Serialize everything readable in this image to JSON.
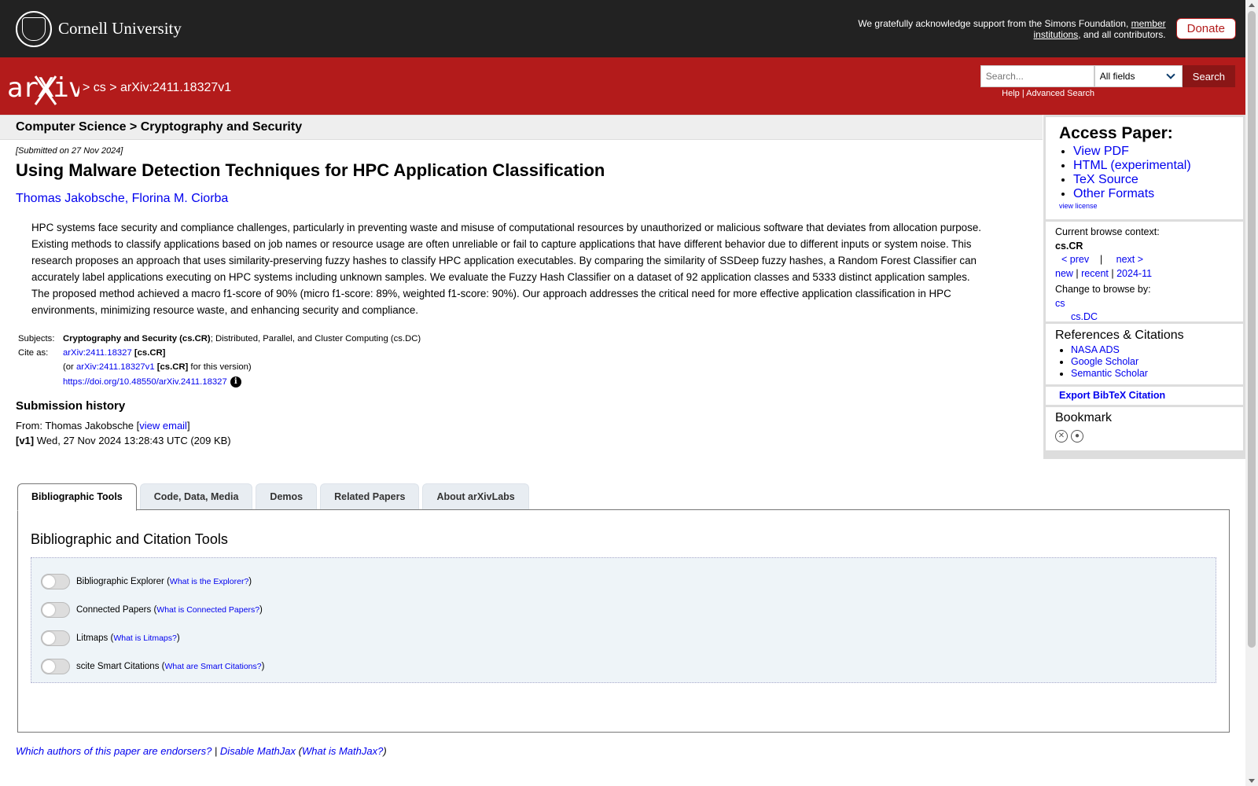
{
  "cornell": {
    "name": "Cornell University",
    "ack_prefix": "We gratefully acknowledge support from the Simons Foundation, ",
    "ack_link": "member institutions",
    "ack_suffix": ", and all contributors.",
    "donate_label": "Donate"
  },
  "header": {
    "logo": "arXiv",
    "breadcrumb": "> cs > arXiv:2411.18327v1",
    "search_placeholder": "Search...",
    "field_select": "All fields",
    "search_label": "Search",
    "help_label": "Help",
    "help_sep": " | ",
    "advanced_label": "Advanced Search"
  },
  "paper": {
    "subject_heading": "Computer Science > Cryptography and Security",
    "submitted": "[Submitted on 27 Nov 2024]",
    "title": "Using Malware Detection Techniques for HPC Application Classification",
    "authors": "Thomas Jakobsche, Florina M. Ciorba",
    "abstract": "HPC systems face security and compliance challenges, particularly in preventing waste and misuse of computational resources by unauthorized or malicious software that deviates from allocation purpose. Existing methods to classify applications based on job names or resource usage are often unreliable or fail to capture applications that have different behavior due to different inputs or system noise. This research proposes an approach that uses similarity-preserving fuzzy hashes to classify HPC application executables. By comparing the similarity of SSDeep fuzzy hashes, a Random Forest Classifier can accurately label applications executing on HPC systems including unknown samples. We evaluate the Fuzzy Hash Classifier on a dataset of 92 application classes and 5333 distinct application samples. The proposed method achieved a macro f1-score of 90% (micro f1-score: 89%, weighted f1-score: 90%). Our approach addresses the critical need for more effective application classification in HPC environments, minimizing resource waste, and enhancing security and compliance.",
    "subjects_label": "Subjects:",
    "subjects_primary": "Cryptography and Security (cs.CR)",
    "subjects_rest": "; Distributed, Parallel, and Cluster Computing (cs.DC)",
    "cite_label": "Cite as:",
    "cite_id": "arXiv:2411.18327",
    "cite_cat": "[cs.CR]",
    "cite_or": "(or ",
    "cite_version_id": "arXiv:2411.18327v1",
    "cite_version_cat": "[cs.CR]",
    "cite_version_suffix": " for this version)",
    "doi": "https://doi.org/10.48550/arXiv.2411.18327",
    "history_heading": "Submission history",
    "from_prefix": "From: Thomas Jakobsche [",
    "view_email": "view email",
    "from_suffix": "]",
    "v1_tag": "[v1]",
    "v1_text": " Wed, 27 Nov 2024 13:28:43 UTC (209 KB)"
  },
  "sidebar": {
    "access_title": "Access Paper:",
    "access_links": [
      "View PDF",
      "HTML (experimental)",
      "TeX Source",
      "Other Formats"
    ],
    "view_license": "view license",
    "browse_context_label": "Current browse context:",
    "browse_context": "cs.CR",
    "prev": "< prev",
    "pipe": "|",
    "next": "next >",
    "new": "new",
    "recent": "recent",
    "month": "2024-11",
    "change_browse": "Change to browse by:",
    "browse_cs": "cs",
    "browse_csdc": "cs.DC",
    "refs_title": "References & Citations",
    "refs_links": [
      "NASA ADS",
      "Google Scholar",
      "Semantic Scholar"
    ],
    "bibtex": "Export BibTeX Citation",
    "bookmark_title": "Bookmark"
  },
  "tabs": [
    "Bibliographic Tools",
    "Code, Data, Media",
    "Demos",
    "Related Papers",
    "About arXivLabs"
  ],
  "panel": {
    "title": "Bibliographic and Citation Tools",
    "tools": [
      {
        "label": "Bibliographic Explorer",
        "link": "What is the Explorer?"
      },
      {
        "label": "Connected Papers",
        "link": "What is Connected Papers?"
      },
      {
        "label": "Litmaps",
        "link": "What is Litmaps?"
      },
      {
        "label": "scite Smart Citations",
        "link": "What are Smart Citations?"
      }
    ]
  },
  "footer": {
    "endorsers": "Which authors of this paper are endorsers?",
    "sep": " | ",
    "mathjax": "Disable MathJax",
    "mathjax_what": "What is MathJax?"
  }
}
